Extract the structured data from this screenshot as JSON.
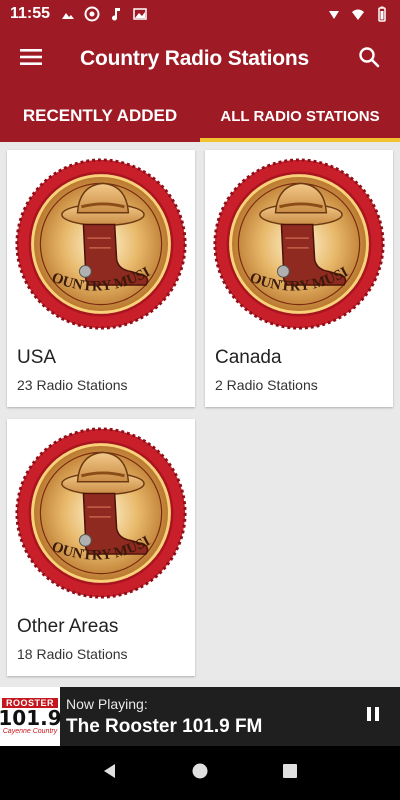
{
  "status_bar": {
    "time": "11:55",
    "left_icons": [
      "image-icon",
      "aperture-icon",
      "music-note-icon",
      "image-icon"
    ],
    "right_icons": [
      "signal-icon",
      "wifi-icon",
      "battery-icon"
    ]
  },
  "app_bar": {
    "title": "Country Radio Stations",
    "menu_icon": "hamburger-menu-icon",
    "search_icon": "search-icon"
  },
  "tabs": [
    {
      "label": "RECENTLY ADDED",
      "active": false
    },
    {
      "label": "ALL RADIO STATIONS",
      "active": true
    }
  ],
  "categories": [
    {
      "name": "USA",
      "count": "23 Radio Stations",
      "badge_text": "COUNTRY MUSIC"
    },
    {
      "name": "Canada",
      "count": "2 Radio Stations",
      "badge_text": "COUNTRY MUSIC"
    },
    {
      "name": "Other Areas",
      "count": "18 Radio Stations",
      "badge_text": "COUNTRY MUSIC"
    }
  ],
  "now_playing": {
    "label": "Now Playing:",
    "station": "The Rooster 101.9 FM",
    "logo_top": "ROOSTER",
    "logo_number": "101.9",
    "logo_tagline": "Cayenne Country",
    "pause_icon": "pause-icon"
  },
  "nav_bar": {
    "icons": [
      "back-icon",
      "home-icon",
      "recents-icon"
    ]
  },
  "colors": {
    "primary": "#9e1b25",
    "tab_indicator": "#f2c230",
    "background": "#e9e9e9",
    "player_bg": "#1f1f1f"
  }
}
